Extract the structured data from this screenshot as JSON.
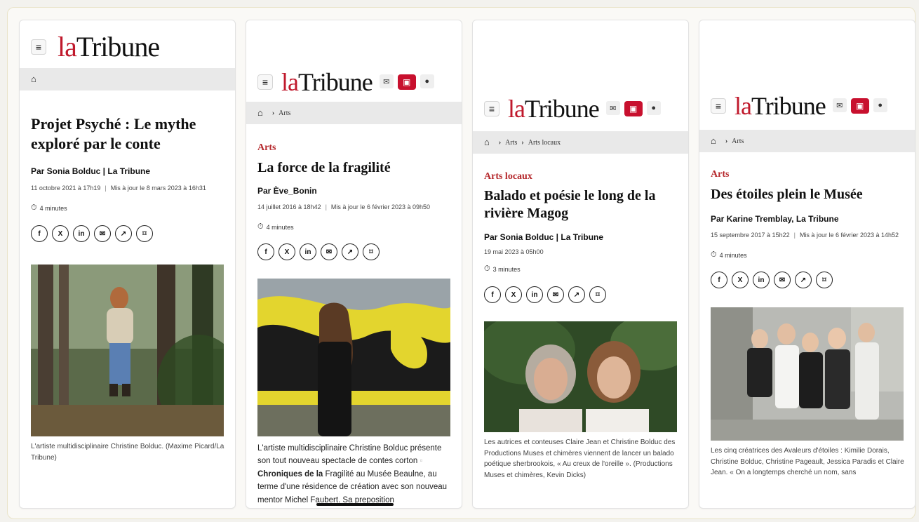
{
  "brand": {
    "la": "la",
    "tribune": "Tribune"
  },
  "icons": {
    "menu": "≡",
    "home": "🏠",
    "chevron": "›",
    "mail": "✉",
    "lock": "🔓",
    "user": "👤",
    "clock": "⏱"
  },
  "share_buttons": [
    "f",
    "X",
    "in",
    "✉",
    "↗",
    "⌑"
  ],
  "colors": {
    "brand_red": "#c0192c",
    "category_red": "#b5282c",
    "breadcrumb_bg": "#e9e9e9"
  },
  "cards": [
    {
      "breadcrumb": [],
      "category": "",
      "title": "Projet Psyché : Le mythe exploré par le conte",
      "byline": "Par Sonia Bolduc | La Tribune",
      "published": "11 octobre 2021 à 17h19",
      "updated": "Mis à jour le 8 mars 2023 à 16h31",
      "duration": "4 minutes",
      "caption": "L'artiste multidisciplinaire Christine Bolduc. (Maxime Picard/La Tribune)"
    },
    {
      "breadcrumb": [
        "Arts"
      ],
      "category": "Arts",
      "title": "La force de la fragilité",
      "byline": "Par Ève_Bonin",
      "published": "14 juillet 2016 à 18h42",
      "updated": "Mis à jour le 6 février 2023 à 09h50",
      "duration": "4 minutes",
      "body_1": "L'artiste multidisciplinaire Christine Bolduc présente son tout nouveau spectacle de contes corton",
      "body_bold": "Chroniques de la",
      "body_2": "Fragilité au Musée Beaulne, au terme d'une résidence de création avec son nouveau mentor Michel Faubert. Sa preposition"
    },
    {
      "breadcrumb": [
        "Arts",
        "Arts locaux"
      ],
      "category": "Arts locaux",
      "title": "Balado et poésie le long de la rivière Magog",
      "byline": "Par Sonia Bolduc | La Tribune",
      "published": "19 mai 2023 à 05h00",
      "updated": "",
      "duration": "3 minutes",
      "caption": "Les autrices et conteuses Claire Jean et Christine Bolduc des Productions Muses et chimères viennent de lancer un balado poétique sherbrookois, « Au creux de l'oreille ». (Productions Muses et chimères, Kevin Dicks)"
    },
    {
      "breadcrumb": [
        "Arts"
      ],
      "category": "Arts",
      "title": "Des étoiles plein le Musée",
      "byline": "Par Karine Tremblay, La Tribune",
      "published": "15 septembre 2017 à 15h22",
      "updated": "Mis à jour le 6 février 2023 à 14h52",
      "duration": "4 minutes",
      "caption": "Les cinq créatrices des Avaleurs d'étoiles : Kimilie Dorais, Christine Bolduc, Christine Pageault, Jessica Paradis et Claire Jean. « On a longtemps cherché un nom, sans"
    }
  ]
}
